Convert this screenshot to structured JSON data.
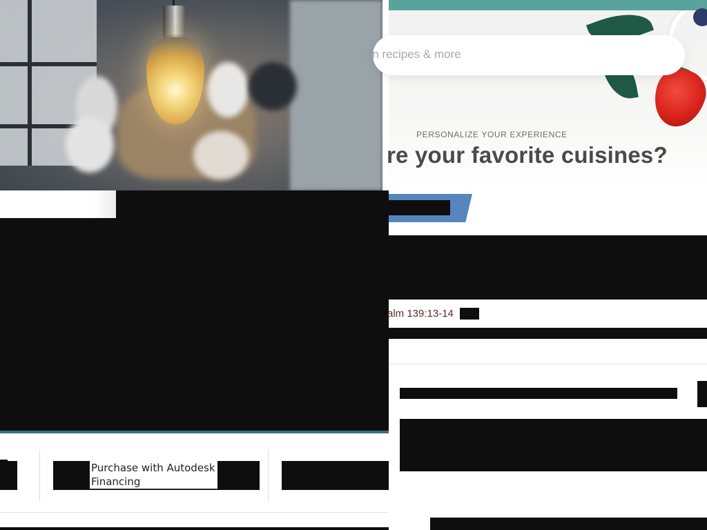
{
  "recipes": {
    "search": {
      "value": "ion recipes & more"
    },
    "eyebrow": "PERSONALIZE YOUR EXPERIENCE",
    "heading": "re your favorite cuisines?",
    "accent_color": "#5aa39d"
  },
  "scripture": {
    "reference": "alm 139:13-14"
  },
  "autodesk": {
    "financing_label": "Purchase with Autodesk Financing",
    "underline_color": "#3b6f8e"
  },
  "icons": {
    "hero_left": "light-bulb-icon",
    "hero_right": "strawberry-icon"
  }
}
